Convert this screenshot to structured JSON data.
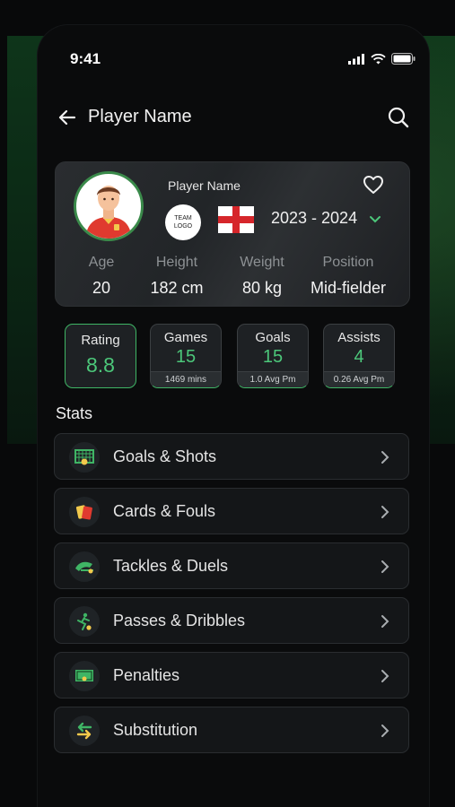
{
  "status_bar": {
    "time": "9:41"
  },
  "header": {
    "title": "Player Name"
  },
  "profile": {
    "name": "Player Name",
    "team_logo_text": "TEAM LOGO",
    "season": "2023 - 2024",
    "attributes": [
      {
        "label": "Age",
        "value": "20"
      },
      {
        "label": "Height",
        "value": "182 cm"
      },
      {
        "label": "Weight",
        "value": "80 kg"
      },
      {
        "label": "Position",
        "value": "Mid-fielder"
      }
    ]
  },
  "summary": {
    "rating": {
      "label": "Rating",
      "value": "8.8"
    },
    "games": {
      "label": "Games",
      "value": "15",
      "sub": "1469 mins"
    },
    "goals": {
      "label": "Goals",
      "value": "15",
      "sub": "1.0 Avg Pm"
    },
    "assists": {
      "label": "Assists",
      "value": "4",
      "sub": "0.26 Avg Pm"
    }
  },
  "stats": {
    "heading": "Stats",
    "items": [
      {
        "label": "Goals & Shots",
        "icon": "goal-net-icon"
      },
      {
        "label": "Cards & Fouls",
        "icon": "cards-icon"
      },
      {
        "label": "Tackles & Duels",
        "icon": "tackle-icon"
      },
      {
        "label": "Passes & Dribbles",
        "icon": "dribble-icon"
      },
      {
        "label": "Penalties",
        "icon": "penalty-goal-icon"
      },
      {
        "label": "Substitution",
        "icon": "substitution-icon"
      }
    ]
  },
  "colors": {
    "accent": "#4cc77a",
    "background": "#0a0b0c",
    "card": "#24272a"
  }
}
